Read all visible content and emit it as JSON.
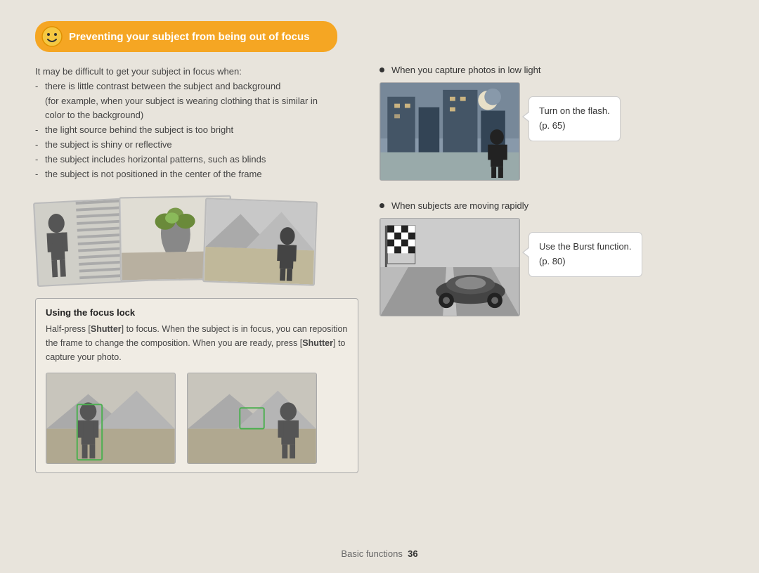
{
  "page": {
    "background_color": "#e8e4dc",
    "footer_text": "Basic functions",
    "page_number": "36"
  },
  "header": {
    "title": "Preventing your subject from being out of focus",
    "icon_alt": "smiley-face-icon",
    "bg_color": "#f5a623"
  },
  "left": {
    "intro": "It may be difficult to get your subject in focus when:",
    "bullets": [
      "there is little contrast between the subject and background (for example, when your subject is wearing clothing that is similar in color to the background)",
      "the light source behind the subject is too bright",
      "the subject is shiny or reflective",
      "the subject includes horizontal patterns, such as blinds",
      "the subject is not positioned in the center of the frame"
    ],
    "focus_lock": {
      "title": "Using the focus lock",
      "text": "Half-press [Shutter] to focus. When the subject is in focus, you can reposition the frame to change the composition. When you are ready, press [Shutter] to capture your photo."
    }
  },
  "right": {
    "section1": {
      "bullet": "When you capture photos in low light",
      "callout_line1": "Turn on the flash.",
      "callout_line2": "(p. 65)"
    },
    "section2": {
      "bullet": "When subjects are moving rapidly",
      "callout_line1": "Use the Burst function.",
      "callout_line2": "(p. 80)"
    }
  }
}
